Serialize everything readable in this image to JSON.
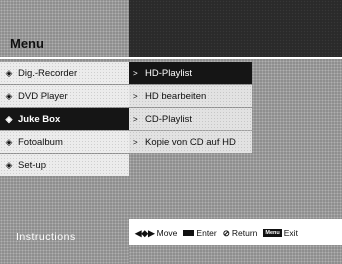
{
  "menu": {
    "title": "Menu",
    "items": [
      {
        "label": "Dig.-Recorder",
        "icon": "diamond-bullet-icon"
      },
      {
        "label": "DVD Player",
        "icon": "diamond-bullet-icon"
      },
      {
        "label": "Juke Box",
        "icon": "diamond-bullet-icon"
      },
      {
        "label": "Fotoalbum",
        "icon": "diamond-bullet-icon"
      },
      {
        "label": "Set-up",
        "icon": "diamond-bullet-icon"
      }
    ],
    "selected_index": 2
  },
  "submenu": {
    "items": [
      {
        "label": "HD-Playlist"
      },
      {
        "label": "HD bearbeiten"
      },
      {
        "label": "CD-Playlist"
      },
      {
        "label": "Kopie von CD auf HD"
      }
    ],
    "selected_index": 0
  },
  "footer": {
    "instructions_label": "Instructions",
    "hints": {
      "move": {
        "icon": "arrows-move-icon",
        "glyph": "◆",
        "label": "Move"
      },
      "enter": {
        "icon": "enter-key-icon",
        "label": "Enter"
      },
      "return": {
        "icon": "return-icon",
        "glyph": "⊘",
        "label": "Return"
      },
      "exit": {
        "icon": "menu-key-icon",
        "key_text": "Menu",
        "label": "Exit"
      }
    }
  },
  "colors": {
    "background_grey": "#9a9a9a",
    "header_dark": "#2a2a2a",
    "selected_bg": "#151515",
    "item_bg": "#ececec"
  }
}
